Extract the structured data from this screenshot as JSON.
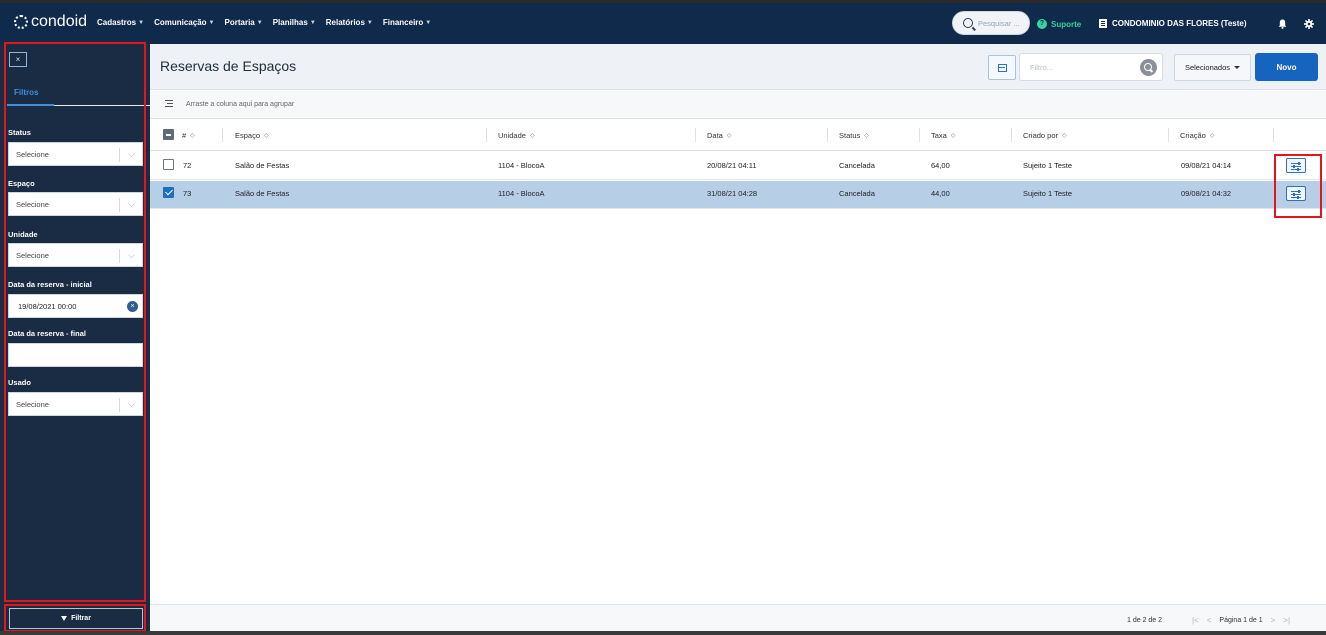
{
  "brand": {
    "name": "condoid"
  },
  "nav": {
    "menu": [
      {
        "label": "Cadastros"
      },
      {
        "label": "Comunicação"
      },
      {
        "label": "Portaria"
      },
      {
        "label": "Planilhas"
      },
      {
        "label": "Relatórios"
      },
      {
        "label": "Financeiro"
      }
    ],
    "search_placeholder": "Pesquisar ...",
    "support_label": "Suporte",
    "condo_name": "CONDOMINIO DAS FLORES (Teste)"
  },
  "sidebar": {
    "close_label": "×",
    "tab_label": "Filtros",
    "filters": [
      {
        "label": "Status",
        "value": "Selecione"
      },
      {
        "label": "Espaço",
        "value": "Selecione"
      },
      {
        "label": "Unidade",
        "value": "Selecione"
      },
      {
        "label": "Data da reserva - inicial",
        "value": "19/08/2021 00:00"
      },
      {
        "label": "Data da reserva - final",
        "value": ""
      },
      {
        "label": "Usado",
        "value": "Selecione"
      }
    ],
    "filter_button": "Filtrar"
  },
  "page": {
    "title": "Reservas de Espaços",
    "filter_placeholder": "Filtro...",
    "select_button": "Selecionados",
    "new_button": "Novo",
    "group_hint": "Arraste a coluna aqui para agrupar"
  },
  "table": {
    "columns": [
      "#",
      "Espaço",
      "Unidade",
      "Data",
      "Status",
      "Taxa",
      "Criado por",
      "Criação"
    ],
    "rows": [
      {
        "id": "72",
        "espaco": "Salão de Festas",
        "unidade": "1104 - BlocoA",
        "data": "20/08/21 04:11",
        "status": "Cancelada",
        "taxa": "64,00",
        "criado_por": "Sujeito 1 Teste",
        "criacao": "09/08/21 04:14",
        "selected": false
      },
      {
        "id": "73",
        "espaco": "Salão de Festas",
        "unidade": "1104 - BlocoA",
        "data": "31/08/21 04:28",
        "status": "Cancelada",
        "taxa": "44,00",
        "criado_por": "Sujeito 1 Teste",
        "criacao": "09/08/21 04:32",
        "selected": true
      }
    ]
  },
  "footer": {
    "count": "1 de 2 de 2",
    "page_label": "Página 1 de 1"
  },
  "colors": {
    "nav_bg": "#0f2a4b",
    "sidebar_bg": "#1a2b44",
    "accent": "#1565c0",
    "selected_row": "#b7cfe6",
    "highlight": "#e3161b"
  }
}
